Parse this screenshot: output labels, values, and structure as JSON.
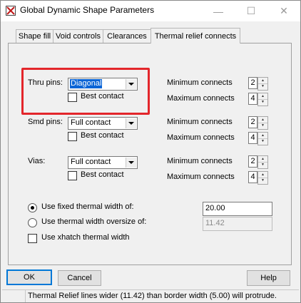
{
  "window": {
    "title": "Global Dynamic Shape Parameters",
    "minimize_glyph": "—",
    "maximize_glyph": "☐",
    "close_glyph": "✕"
  },
  "tabs": [
    "Shape fill",
    "Void controls",
    "Clearances",
    "Thermal relief connects"
  ],
  "active_tab": "Thermal relief connects",
  "rows": [
    {
      "label": "Thru pins:",
      "type": "Diagonal",
      "best_contact": "Best contact",
      "best_contact_checked": false,
      "min_label": "Minimum connects",
      "min_value": "2",
      "max_label": "Maximum connects",
      "max_value": "4"
    },
    {
      "label": "Smd pins:",
      "type": "Full contact",
      "best_contact": "Best contact",
      "best_contact_checked": false,
      "min_label": "Minimum connects",
      "min_value": "2",
      "max_label": "Maximum connects",
      "max_value": "4"
    },
    {
      "label": "Vias:",
      "type": "Full contact",
      "best_contact": "Best contact",
      "best_contact_checked": false,
      "min_label": "Minimum connects",
      "min_value": "2",
      "max_label": "Maximum connects",
      "max_value": "4"
    }
  ],
  "width": {
    "fixed_label": "Use fixed thermal width of:",
    "fixed_value": "20.00",
    "oversize_label": "Use thermal width oversize of:",
    "oversize_value": "11.42",
    "xhatch_label": "Use xhatch thermal width",
    "selected": "fixed"
  },
  "buttons": {
    "ok": "OK",
    "cancel": "Cancel",
    "help": "Help"
  },
  "status_text": "Thermal Relief lines wider (11.42) than border width (5.00) will protrude.",
  "colors": {
    "selection": "#0a64d6",
    "highlight_box": "#e3262b"
  }
}
